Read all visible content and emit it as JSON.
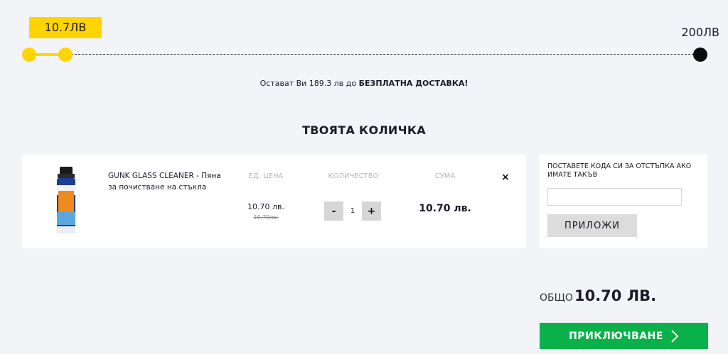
{
  "progress": {
    "current_label": "10.7ЛВ",
    "goal_label": "200ЛВ",
    "fraction": 0.0535
  },
  "shipping": {
    "prefix": "Остават Ви 189.3 лв до",
    "highlight": "БЕЗПЛАТНА ДОСТАВКА!"
  },
  "cart": {
    "title": "ТВОЯТА КОЛИЧКА",
    "columns": {
      "unit_price": "ЕД. ЦЕНА",
      "quantity": "КОЛИЧЕСТВО",
      "sum": "СУМА"
    },
    "items": [
      {
        "name": "GUNK GLASS CLEANER - Пяна за почистване на стъкла",
        "unit_price": "10.70 лв.",
        "old_price": "10,70лв.",
        "qty_minus": "-",
        "quantity": "1",
        "qty_plus": "+",
        "sum": "10.70 лв.",
        "remove": "×",
        "image_icon": "spray-can-icon"
      }
    ]
  },
  "coupon": {
    "label": "ПОСТАВЕТЕ КОДА СИ ЗА ОТСТЪПКА АКО ИМАТЕ ТАКЪВ",
    "placeholder": "",
    "button": "ПРИЛОЖИ"
  },
  "total": {
    "label": "ОБЩО",
    "value": "10.70 ЛВ."
  },
  "checkout": {
    "label": "ПРИКЛЮЧВАНЕ",
    "icon": "chevron-right-icon"
  },
  "colors": {
    "accent": "#ffd400",
    "checkout": "#0ab14a",
    "background": "#f3f4f8"
  }
}
